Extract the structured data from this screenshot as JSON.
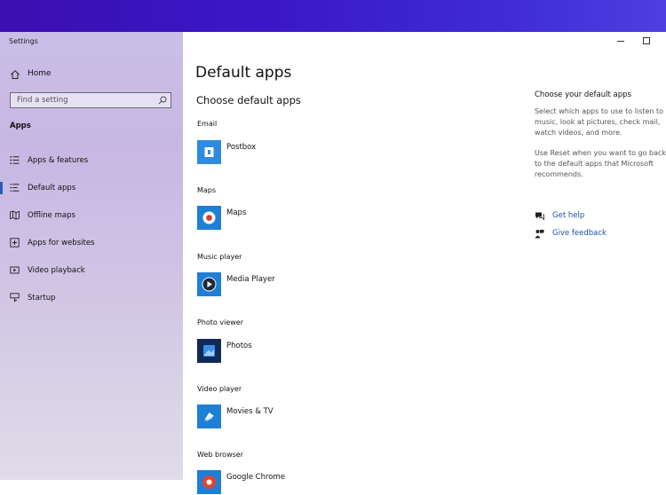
{
  "window": {
    "title": "Settings"
  },
  "sidebar": {
    "home_label": "Home",
    "search_placeholder": "Find a setting",
    "section_title": "Apps",
    "items": [
      {
        "label": "Apps & features",
        "icon": "list-icon",
        "selected": false
      },
      {
        "label": "Default apps",
        "icon": "defaults-icon",
        "selected": true
      },
      {
        "label": "Offline maps",
        "icon": "map-icon",
        "selected": false
      },
      {
        "label": "Apps for websites",
        "icon": "web-app-icon",
        "selected": false
      },
      {
        "label": "Video playback",
        "icon": "video-icon",
        "selected": false
      },
      {
        "label": "Startup",
        "icon": "startup-icon",
        "selected": false
      }
    ]
  },
  "main": {
    "title": "Default apps",
    "subtitle": "Choose default apps",
    "categories": [
      {
        "label": "Email",
        "app": "Postbox",
        "icon": "postbox-icon"
      },
      {
        "label": "Maps",
        "app": "Maps",
        "icon": "maps-icon"
      },
      {
        "label": "Music player",
        "app": "Media Player",
        "icon": "media-player-icon"
      },
      {
        "label": "Photo viewer",
        "app": "Photos",
        "icon": "photos-icon"
      },
      {
        "label": "Video player",
        "app": "Movies & TV",
        "icon": "movies-tv-icon"
      },
      {
        "label": "Web browser",
        "app": "Google Chrome",
        "icon": "chrome-icon"
      }
    ]
  },
  "side_panel": {
    "title": "Choose your default apps",
    "text1": "Select which apps to use to listen to music, look at pictures, check mail, watch videos, and more.",
    "text2": "Use Reset when you want to go back to the default apps that Microsoft recommends.",
    "get_help": "Get help",
    "give_feedback": "Give feedback"
  },
  "colors": {
    "accent": "#1a7fd4",
    "link": "#1a52a8",
    "tile_blue": "#1e88e5"
  }
}
